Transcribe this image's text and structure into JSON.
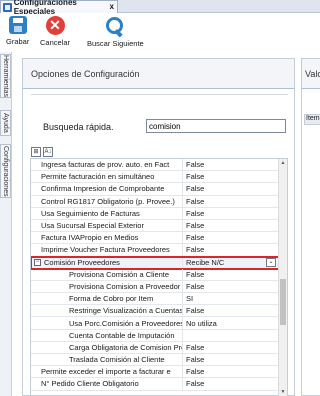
{
  "window": {
    "tab_title": "Configuraciones Especiales",
    "close_glyph": "x"
  },
  "toolbar": {
    "save_label": "Grabar",
    "cancel_label": "Cancelar",
    "search_next_label": "Buscar Siguiente"
  },
  "sidebar": {
    "tabs": [
      "Herramientas",
      "Ayuda",
      "Configuraciones"
    ]
  },
  "panel": {
    "title": "Opciones de Configuración",
    "quick_search_label": "Busqueda rápida.",
    "quick_search_value": "comision",
    "sort_glyphs": [
      "⊞",
      "A↓"
    ]
  },
  "right_panel": {
    "title": "Valo",
    "column": "Item"
  },
  "grid": {
    "rows": [
      {
        "name": "Ingresa facturas de prov. auto. en Fact",
        "value": "False"
      },
      {
        "name": "Permite facturación en simultáneo",
        "value": "False"
      },
      {
        "name": "Confirma Impresion de Comprobante",
        "value": "False"
      },
      {
        "name": "Control RG1817 Obligatorio (p. Provee.)",
        "value": "False"
      },
      {
        "name": "Usa Seguimiento de Facturas",
        "value": "False"
      },
      {
        "name": "Usa Sucursal Especial Exterior",
        "value": "False"
      },
      {
        "name": "Factura IVAPropio en Medios",
        "value": "False"
      },
      {
        "name": "Imprime Voucher Factura Proveedores",
        "value": "False"
      },
      {
        "name": "Comisión Proveedores",
        "value": "Recibe N/C",
        "expander": "−"
      },
      {
        "name": "Provisiona Comisión a Cliente",
        "value": "False"
      },
      {
        "name": "Provisiona Comision a Proveedor",
        "value": "False"
      },
      {
        "name": "Forma de Cobro por Item",
        "value": "SI"
      },
      {
        "name": "Restringe Visualización a Cuentas",
        "value": "False"
      },
      {
        "name": "Usa Porc.Comisión a Proveedores Por",
        "value": "No utiliza"
      },
      {
        "name": "Cuenta Contable de Imputación",
        "value": ""
      },
      {
        "name": "Carga Obligatoria de Comision Prov",
        "value": "False"
      },
      {
        "name": "Traslada Comisión al Cliente",
        "value": "False"
      },
      {
        "name": "Permite exceder el importe a facturar e",
        "value": "False"
      },
      {
        "name": "N° Pedido Cliente Obligatorio",
        "value": "False"
      }
    ]
  },
  "colors": {
    "accent": "#2f7fc7",
    "danger": "#e0403a",
    "highlight_border": "#d9262b"
  }
}
